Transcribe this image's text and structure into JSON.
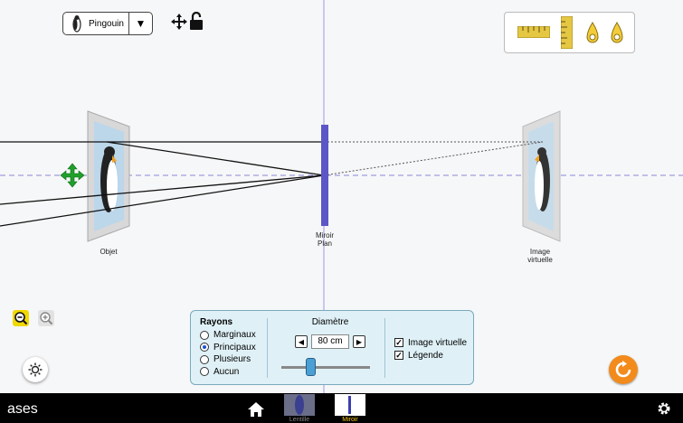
{
  "scene": {
    "object_label": "Objet",
    "mirror_label_1": "Miroir",
    "mirror_label_2": "Plan",
    "image_label_1": "Image",
    "image_label_2": "virtuelle"
  },
  "object_selector": {
    "selected": "Pingouin",
    "icon": "penguin-icon"
  },
  "rays_panel": {
    "title": "Rayons",
    "options": [
      "Marginaux",
      "Principaux",
      "Plusieurs",
      "Aucun"
    ],
    "selected": "Principaux"
  },
  "diameter_panel": {
    "title": "Diamètre",
    "value": "80 cm",
    "slider_fraction": 0.3
  },
  "display_options": {
    "virtual_image": "Image virtuelle",
    "virtual_image_checked": true,
    "legend": "Légende",
    "legend_checked": true
  },
  "navbar": {
    "title": "ases",
    "tabs": [
      {
        "label": "Lentille",
        "active": false
      },
      {
        "label": "Miroir",
        "active": true
      }
    ]
  },
  "colors": {
    "mirror": "#5b57c6",
    "axis": "#8a85d6",
    "active_tab": "#f5c518",
    "reset": "#f28b1c",
    "zoom_active": "#f0d800",
    "panel_bg": "#dff1f7"
  }
}
